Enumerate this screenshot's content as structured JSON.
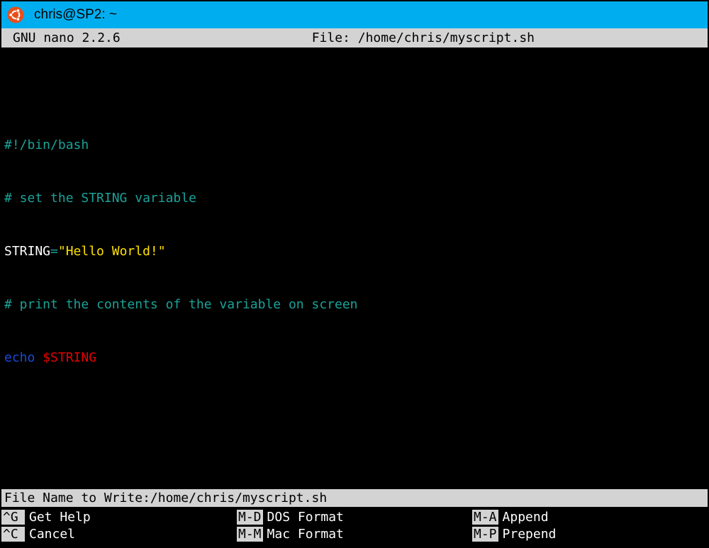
{
  "window": {
    "title": "chris@SP2: ~"
  },
  "nano": {
    "version": "GNU nano 2.2.6",
    "file_label": "File: /home/chris/myscript.sh"
  },
  "editor": {
    "line1": "#!/bin/bash",
    "line2": "# set the STRING variable",
    "line3_var": "STRING",
    "line3_eq": "=",
    "line3_str": "\"Hello World!\"",
    "line4": "# print the contents of the variable on screen",
    "line5_cmd": "echo",
    "line5_sp": " ",
    "line5_var": "$STRING"
  },
  "prompt": {
    "label": "File Name to Write: ",
    "value": "/home/chris/myscript.sh"
  },
  "shortcuts": {
    "c1r1_key": "^G",
    "c1r1_label": "Get Help",
    "c1r2_key": "^C",
    "c1r2_label": "Cancel",
    "c2r1_key": "M-D",
    "c2r1_label": "DOS Format",
    "c2r2_key": "M-M",
    "c2r2_label": "Mac Format",
    "c3r1_key": "M-A",
    "c3r1_label": "Append",
    "c3r2_key": "M-P",
    "c3r2_label": "Prepend"
  }
}
